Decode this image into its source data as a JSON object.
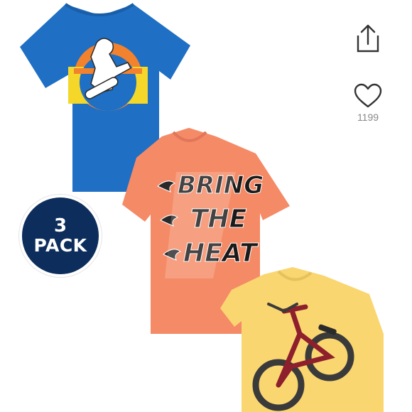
{
  "product": {
    "badge": {
      "count": "3",
      "word": "PACK",
      "color": "#0d2e5c"
    },
    "shirts": [
      {
        "color": "#1f6fc4",
        "graphic": "skateboarder"
      },
      {
        "color": "#f58a66",
        "graphic": "bring-the-heat",
        "lines": [
          "BRING",
          "THE",
          "HEAT"
        ]
      },
      {
        "color": "#fad670",
        "graphic": "bmx-bike"
      }
    ]
  },
  "actions": {
    "share_icon": "share-icon",
    "like_icon": "heart-icon",
    "like_count": "1199"
  }
}
